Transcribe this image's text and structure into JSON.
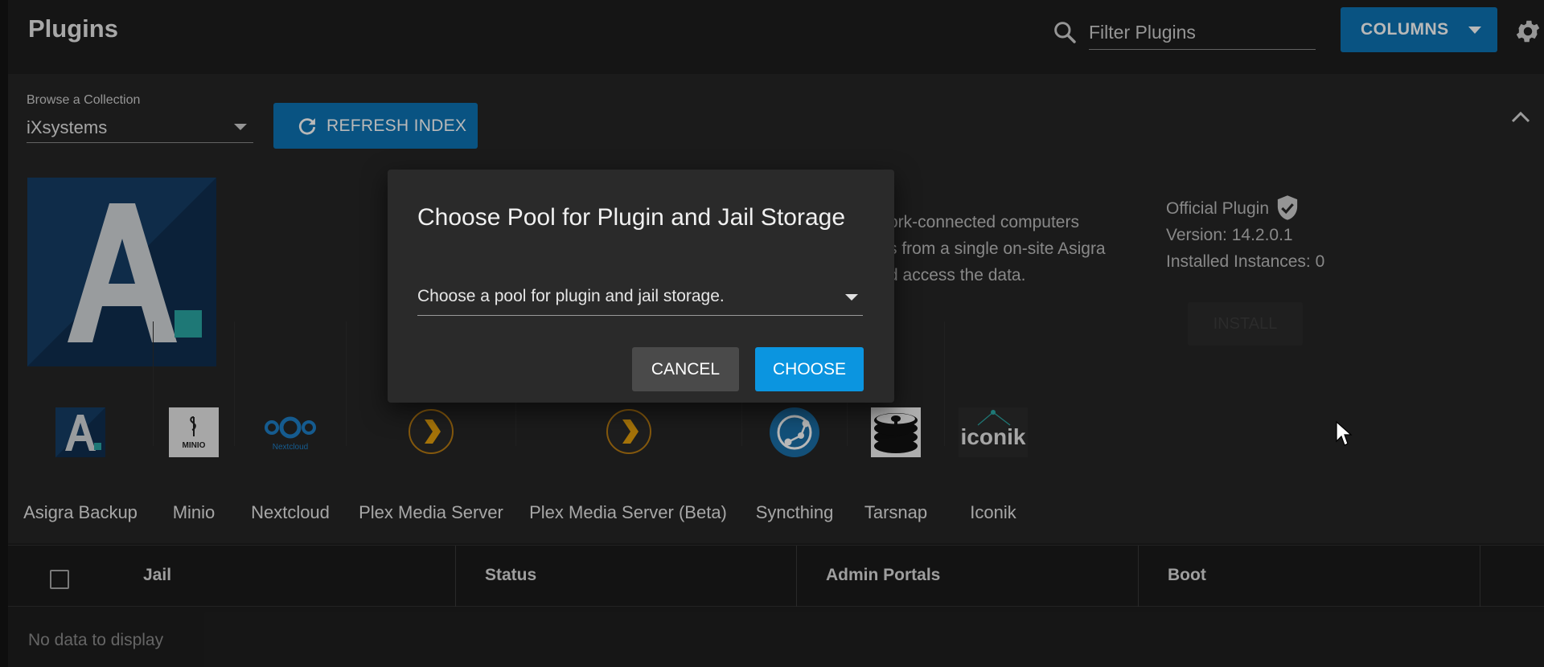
{
  "header": {
    "title": "Plugins",
    "filter_placeholder": "Filter Plugins",
    "columns_label": "COLUMNS"
  },
  "collection": {
    "browse_label": "Browse a Collection",
    "selected": "iXsystems",
    "refresh_label": "REFRESH INDEX"
  },
  "plugin_detail": {
    "description_lines": [
      "ork-connected computers",
      "s from a single on-site Asigra",
      "d access the data."
    ],
    "official_label": "Official Plugin",
    "version": "Version: 14.2.0.1",
    "instances": "Installed Instances: 0",
    "install_label": "INSTALL"
  },
  "plugins": [
    {
      "name": "Asigra Backup",
      "icon": "asigra-icon"
    },
    {
      "name": "Minio",
      "icon": "minio-icon"
    },
    {
      "name": "Nextcloud",
      "icon": "nextcloud-icon"
    },
    {
      "name": "Plex Media Server",
      "icon": "plex-icon"
    },
    {
      "name": "Plex Media Server (Beta)",
      "icon": "plex-icon"
    },
    {
      "name": "Syncthing",
      "icon": "syncthing-icon"
    },
    {
      "name": "Tarsnap",
      "icon": "tarsnap-icon"
    },
    {
      "name": "Iconik",
      "icon": "iconik-icon"
    }
  ],
  "icon_text": {
    "minio": "MINIO",
    "nextcloud": "Nextcloud",
    "iconik": "iconik"
  },
  "table": {
    "columns": [
      "Jail",
      "Status",
      "Admin Portals",
      "Boot"
    ],
    "empty_message": "No data to display"
  },
  "dialog": {
    "title": "Choose Pool for Plugin and Jail Storage",
    "select_placeholder": "Choose a pool for plugin and jail storage.",
    "cancel_label": "CANCEL",
    "choose_label": "CHOOSE"
  },
  "colors": {
    "accent": "#0d73b5",
    "choose": "#0b95e0",
    "background": "#1e1e1e"
  }
}
